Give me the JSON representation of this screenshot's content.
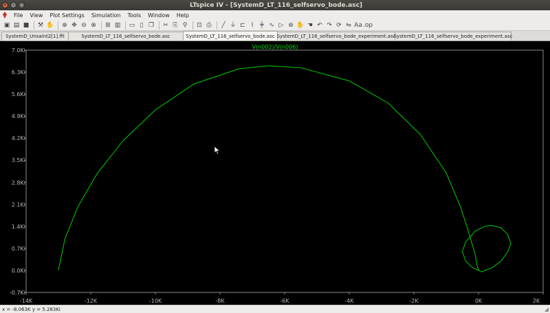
{
  "window": {
    "title": "LTspice IV - [SystemD_LT_116_selfservo_bode.asc]",
    "close_glyph": "×",
    "min_glyph": "–",
    "max_glyph": "□"
  },
  "menu": {
    "items": [
      "File",
      "View",
      "Plot Settings",
      "Simulation",
      "Tools",
      "Window",
      "Help"
    ]
  },
  "toolbar": {
    "buttons": [
      {
        "icon": "new-schematic-icon",
        "glyph": "▣"
      },
      {
        "icon": "open-icon",
        "glyph": "▤"
      },
      {
        "icon": "save-icon",
        "glyph": "■"
      },
      {
        "sep": true
      },
      {
        "icon": "control-panel-icon",
        "glyph": "⚒"
      },
      {
        "icon": "run-icon",
        "glyph": "✋"
      },
      {
        "sep": true
      },
      {
        "icon": "zoom-in-icon",
        "glyph": "⊕"
      },
      {
        "icon": "zoom-pan-icon",
        "glyph": "✥"
      },
      {
        "icon": "zoom-out-icon",
        "glyph": "⊖"
      },
      {
        "icon": "zoom-cancel-icon",
        "glyph": "⊗"
      },
      {
        "sep": true
      },
      {
        "icon": "autorange-icon",
        "glyph": "⊞"
      },
      {
        "icon": "fft-icon",
        "glyph": "▥"
      },
      {
        "sep": true
      },
      {
        "icon": "tile-horizontal-icon",
        "glyph": "▭"
      },
      {
        "icon": "tile-vertical-icon",
        "glyph": "▯"
      },
      {
        "icon": "cascade-icon",
        "glyph": "❐"
      },
      {
        "sep": true
      },
      {
        "icon": "cut-icon",
        "glyph": "✂"
      },
      {
        "icon": "copy-icon",
        "glyph": "⎘"
      },
      {
        "icon": "find-icon",
        "glyph": "⚲"
      },
      {
        "sep": true
      },
      {
        "icon": "print-preview-icon",
        "glyph": "⊡"
      },
      {
        "icon": "print-icon",
        "glyph": "⎙"
      },
      {
        "sep": true
      },
      {
        "icon": "draw-wire-icon",
        "glyph": "╱"
      },
      {
        "icon": "ground-icon",
        "glyph": "⏚"
      },
      {
        "icon": "label-net-icon",
        "glyph": "⊏"
      },
      {
        "icon": "resistor-icon",
        "glyph": "⌇"
      },
      {
        "icon": "capacitor-icon",
        "glyph": "╪"
      },
      {
        "icon": "inductor-icon",
        "glyph": "∿"
      },
      {
        "icon": "diode-icon",
        "glyph": "▷"
      },
      {
        "icon": "component-icon",
        "glyph": "⊛"
      },
      {
        "icon": "move-icon",
        "glyph": "✋"
      },
      {
        "icon": "drag-icon",
        "glyph": "☚"
      },
      {
        "icon": "undo-icon",
        "glyph": "↶"
      },
      {
        "icon": "redo-icon",
        "glyph": "↷"
      },
      {
        "icon": "rotate-icon",
        "glyph": "⟳"
      },
      {
        "icon": "mirror-icon",
        "glyph": "⇋"
      },
      {
        "icon": "text-icon",
        "glyph": "Aa"
      },
      {
        "icon": "spice-directive-icon",
        "glyph": ".op"
      }
    ]
  },
  "tabs": [
    {
      "label": "SystemD_Unsaint2[1].fft",
      "active": false
    },
    {
      "label": "SystemD_LT_116_selfservo_bode.asc",
      "active": false
    },
    {
      "label": "SystemD_LT_116_selfservo_bode.asc",
      "active": true
    },
    {
      "label": "SystemD_LT_116_selfservo_bode_experiment.asc",
      "active": false
    },
    {
      "label": "SystemD_LT_116_selfservo_bode_experiment.asc",
      "active": false
    }
  ],
  "chart_data": {
    "type": "line",
    "title": "V(n002)/V(n006)",
    "xlabel": "",
    "ylabel": "",
    "xlim": [
      -14000,
      2000
    ],
    "ylim": [
      -700,
      7000
    ],
    "x_ticks": [
      "-14K",
      "-12K",
      "-10K",
      "-8K",
      "-6K",
      "-4K",
      "-2K",
      "0K",
      "2K"
    ],
    "y_ticks": [
      "7.0Ki",
      "6.3Ki",
      "5.6Ki",
      "4.9Ki",
      "4.2Ki",
      "3.5Ki",
      "2.8Ki",
      "2.1Ki",
      "1.4Ki",
      "0.7Ki",
      "0.0Ki",
      "-0.7Ki"
    ],
    "grid": false,
    "color": "#00d000",
    "series": [
      {
        "x": [
          -13000,
          -12800,
          -12400,
          -11800,
          -11000,
          -10000,
          -8800,
          -7400,
          -6500,
          -5500,
          -4000,
          -2800,
          -1800,
          -1000,
          -550,
          -300,
          -100,
          -50,
          0
        ],
        "y": [
          0,
          1000,
          2020,
          3080,
          4120,
          5100,
          5930,
          6410,
          6500,
          6440,
          6020,
          5320,
          4320,
          3100,
          2000,
          1200,
          500,
          200,
          0
        ]
      },
      {
        "x": [
          0,
          100,
          200,
          400,
          700,
          900,
          1000,
          900,
          700,
          400,
          200,
          -100,
          -400,
          -500,
          -400,
          -200,
          0
        ],
        "y": [
          0,
          -50,
          0,
          70,
          300,
          580,
          850,
          1150,
          1350,
          1430,
          1400,
          1250,
          900,
          600,
          300,
          100,
          0
        ]
      }
    ]
  },
  "status": {
    "readout": "x = -8.063K   y = 5.283Ki"
  }
}
